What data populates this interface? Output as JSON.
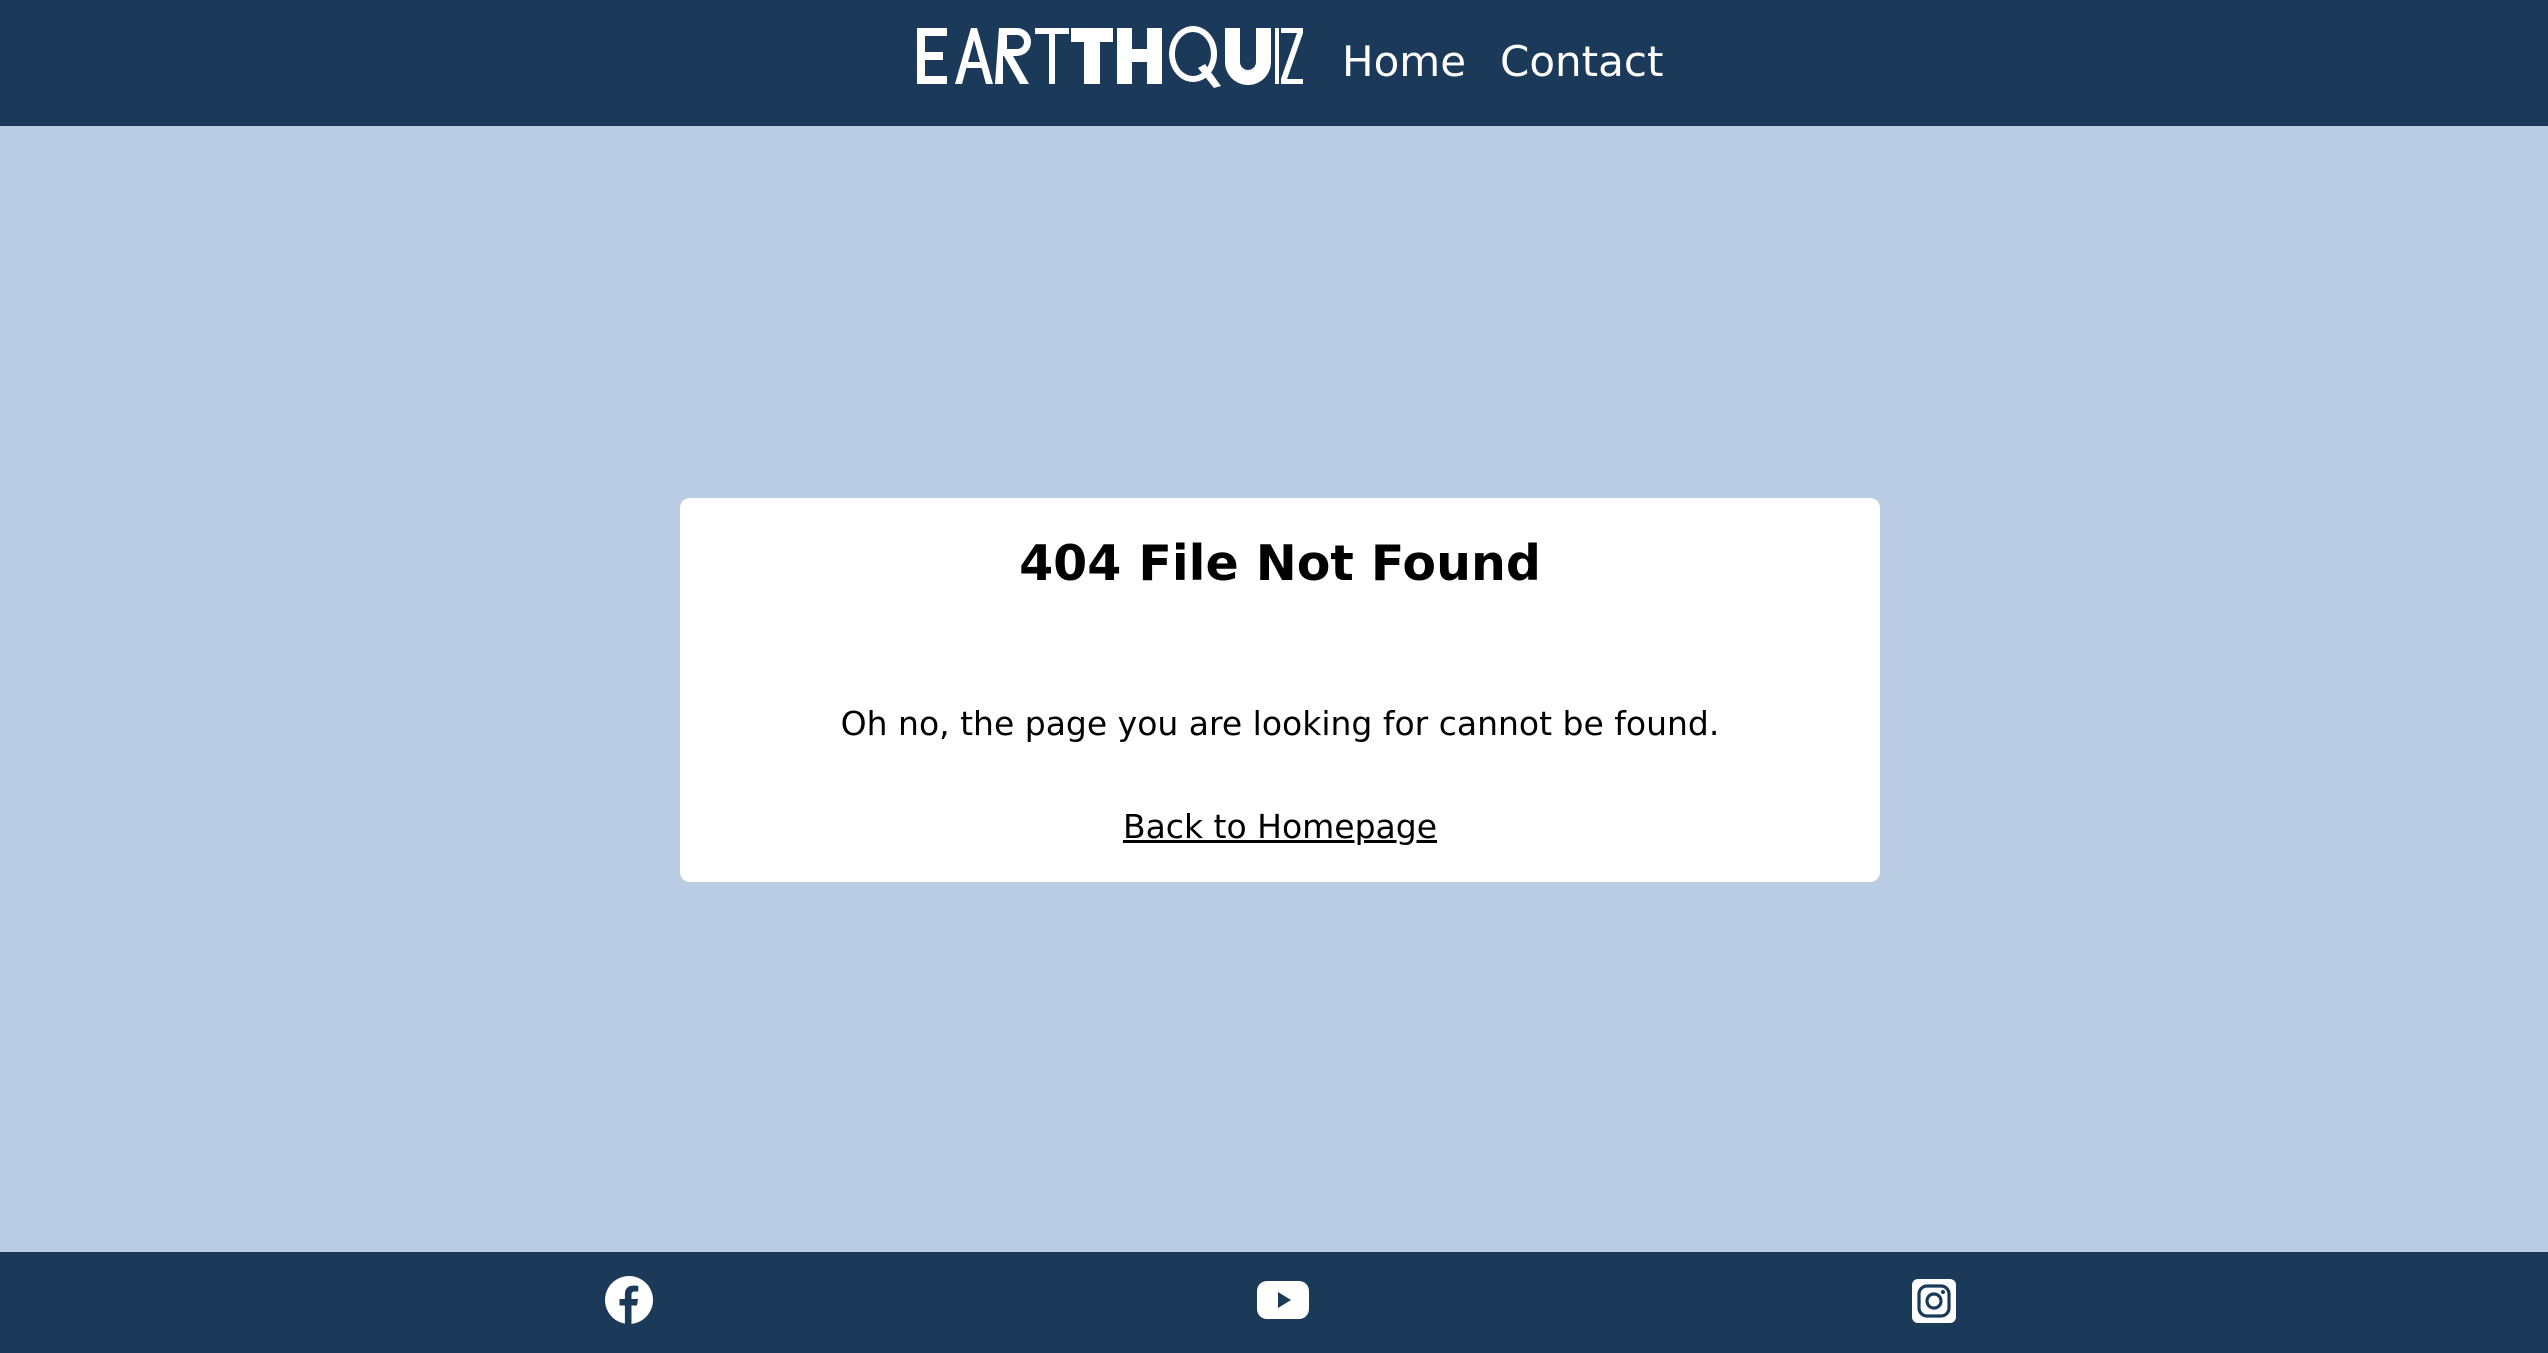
{
  "header": {
    "logo_text": "EARTHQUIZ",
    "nav": {
      "home_label": "Home",
      "contact_label": "Contact"
    }
  },
  "main": {
    "title": "404 File Not Found",
    "message": "Oh no, the page you are looking for cannot be found.",
    "back_link_label": "Back to Homepage"
  },
  "footer": {
    "social_icons": [
      "facebook-icon",
      "youtube-icon",
      "instagram-icon"
    ]
  },
  "colors": {
    "header_bg": "#1b3a5a",
    "page_bg": "#bbcde5",
    "card_bg": "#ffffff"
  }
}
